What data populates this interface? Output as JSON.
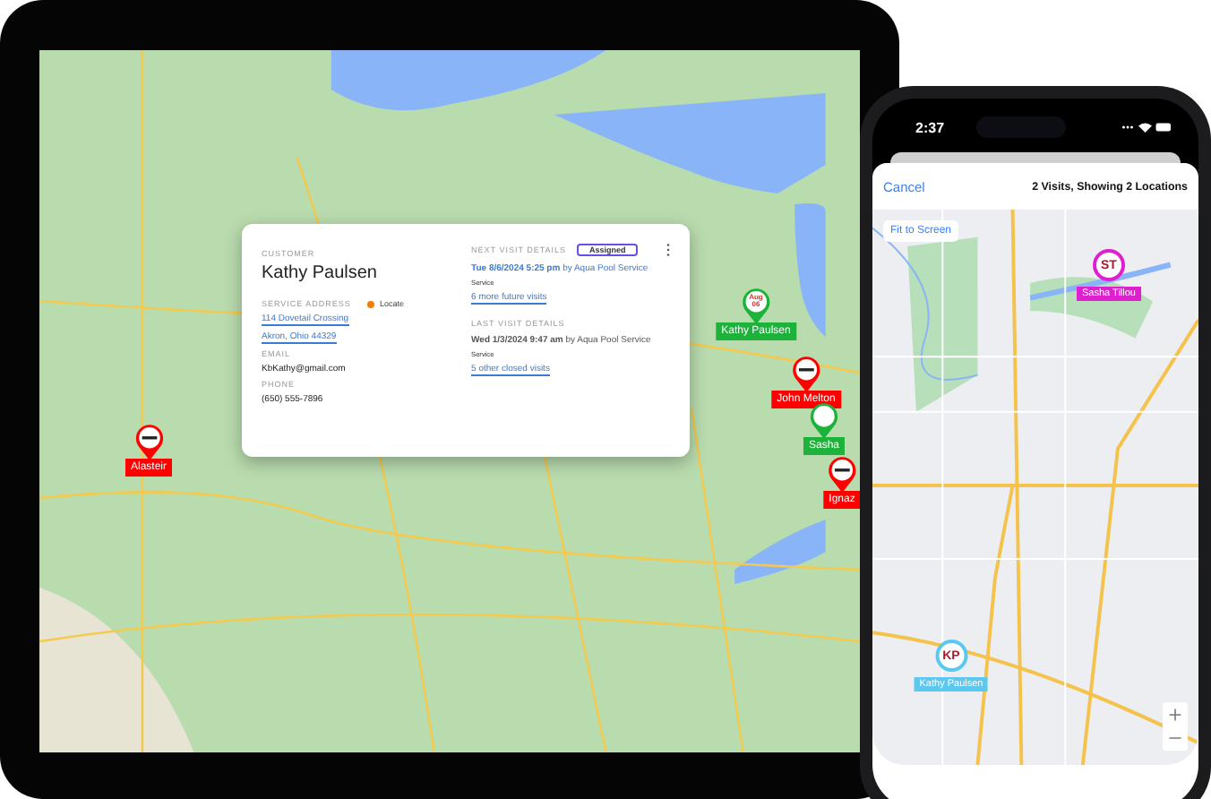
{
  "map": {
    "pins": [
      {
        "label": "Alasteir",
        "kind": "blocked",
        "color": "#ff0000"
      },
      {
        "label": "Kathy Paulsen",
        "kind": "date",
        "pin_text": "Aug 06",
        "color": "#1db33a"
      },
      {
        "label": "John Melton",
        "kind": "blocked",
        "color": "#ff0000"
      },
      {
        "label": "Sasha",
        "kind": "date",
        "color": "#1db33a"
      },
      {
        "label": "Ignaz",
        "kind": "blocked",
        "color": "#ff0000"
      }
    ]
  },
  "popup": {
    "customer_label": "CUSTOMER",
    "customer_name": "Kathy Paulsen",
    "address_label": "SERVICE ADDRESS",
    "locate": "Locate",
    "address_lines": [
      "114 Dovetail Crossing",
      "Akron, Ohio 44329"
    ],
    "email_label": "EMAIL",
    "email": "KbKathy@gmail.com",
    "phone_label": "PHONE",
    "phone": "(650) 555-7896",
    "next_visit": {
      "label": "NEXT VISIT DETAILS",
      "badge": "Assigned",
      "when": "**Tue 8/6/2024 5:25 pm** by Aqua Pool Service",
      "type": "Service",
      "link": "6 more future visits"
    },
    "last_visit": {
      "label": "LAST VISIT DETAILS",
      "when": "**Wed 1/3/2024 9:47 am** by Aqua Pool Service",
      "type": "Service",
      "link": "5 other closed visits"
    }
  },
  "phone": {
    "status_bar": {
      "time": "2:37"
    },
    "header": {
      "cancel": "Cancel",
      "title": "2 Visits, Showing 2 Locations"
    },
    "fit_button": "Fit to Screen",
    "pins": [
      {
        "initials": "ST",
        "label": "Sasha Tillou",
        "color": "#e020d0"
      },
      {
        "initials": "KP",
        "label": "Kathy Paulsen",
        "color": "#5bc8f0"
      }
    ]
  }
}
